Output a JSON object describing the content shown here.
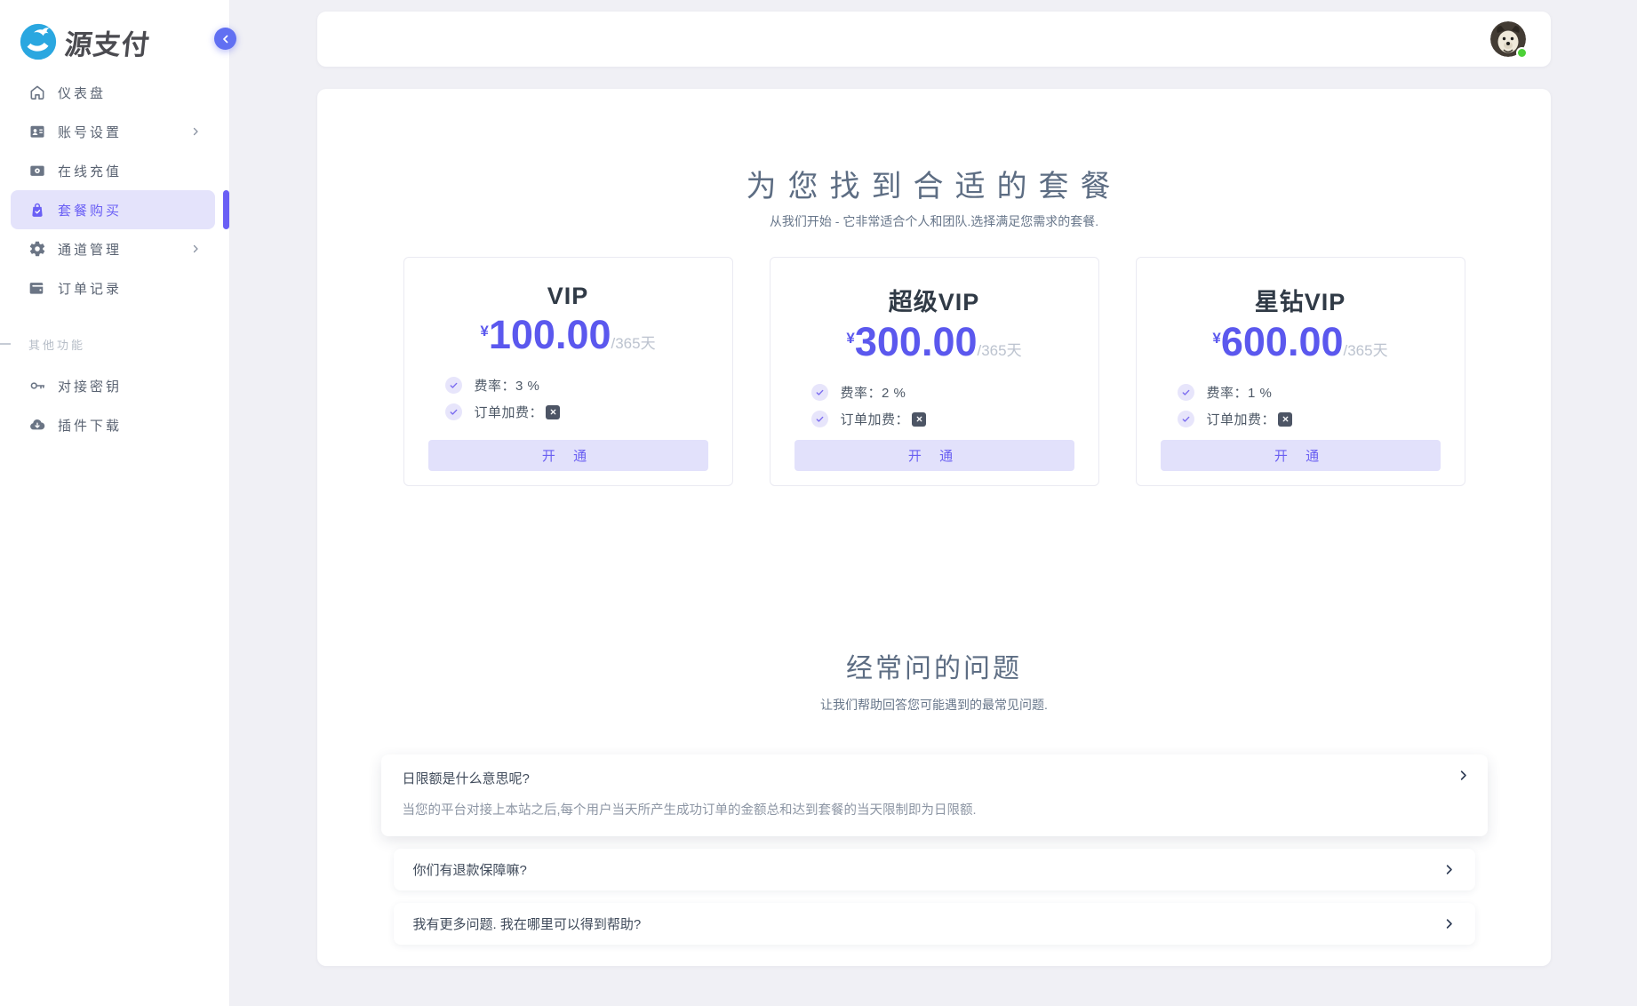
{
  "colors": {
    "accent_purple": "#6a5ff5",
    "price_indigo": "#5b58ee",
    "active_item_bg": "#e4e3fb",
    "open_button_bg": "#e2e1fb",
    "logo_blue": "#2aa7e0",
    "online_green": "#4cd137",
    "heading_slate": "#5d6d83",
    "page_bg": "#f0f0f5",
    "x_badge_bg": "#4d5565"
  },
  "brand": {
    "logo_text": "源支付"
  },
  "topbar": {
    "avatar": "dog-avatar",
    "status": "online"
  },
  "sidebar": {
    "collapse_icon": "chevron-left-icon",
    "menu": [
      {
        "label": "仪表盘",
        "icon": "home-icon",
        "arrow": false,
        "active": false
      },
      {
        "label": "账号设置",
        "icon": "id-card-icon",
        "arrow": true,
        "active": false
      },
      {
        "label": "在线充值",
        "icon": "recharge-icon",
        "arrow": false,
        "active": false
      },
      {
        "label": "套餐购买",
        "icon": "shopping-bag-icon",
        "arrow": false,
        "active": true
      },
      {
        "label": "通道管理",
        "icon": "gear-icon",
        "arrow": true,
        "active": false
      },
      {
        "label": "订单记录",
        "icon": "wallet-icon",
        "arrow": false,
        "active": false
      }
    ],
    "section_label": "其他功能",
    "extra": [
      {
        "label": "对接密钥",
        "icon": "key-icon",
        "arrow": false,
        "active": false
      },
      {
        "label": "插件下载",
        "icon": "cloud-download-icon",
        "arrow": false,
        "active": false
      }
    ]
  },
  "pricing": {
    "title": "为您找到合适的套餐",
    "subtitle": "从我们开始 - 它非常适合个人和团队.选择满足您需求的套餐.",
    "currency": "¥",
    "period": "/365天",
    "open_button_label": "开 通",
    "plans": [
      {
        "name": "VIP",
        "price": "100.00",
        "features": [
          {
            "text": "费率：3 %",
            "badge": false
          },
          {
            "text": "订单加费：",
            "badge": true
          }
        ]
      },
      {
        "name": "超级VIP",
        "price": "300.00",
        "features": [
          {
            "text": "费率：2 %",
            "badge": false
          },
          {
            "text": "订单加费：",
            "badge": true
          }
        ]
      },
      {
        "name": "星钻VIP",
        "price": "600.00",
        "features": [
          {
            "text": "费率：1 %",
            "badge": false
          },
          {
            "text": "订单加费：",
            "badge": true
          }
        ]
      }
    ]
  },
  "faq": {
    "title": "经常问的问题",
    "subtitle": "让我们帮助回答您可能遇到的最常见问题.",
    "items": [
      {
        "question": "日限额是什么意思呢?",
        "answer": "当您的平台对接上本站之后,每个用户当天所产生成功订单的金额总和达到套餐的当天限制即为日限额.",
        "expanded": true
      },
      {
        "question": "你们有退款保障嘛?",
        "answer": "",
        "expanded": false
      },
      {
        "question": "我有更多问题. 我在哪里可以得到帮助?",
        "answer": "",
        "expanded": false
      }
    ]
  }
}
